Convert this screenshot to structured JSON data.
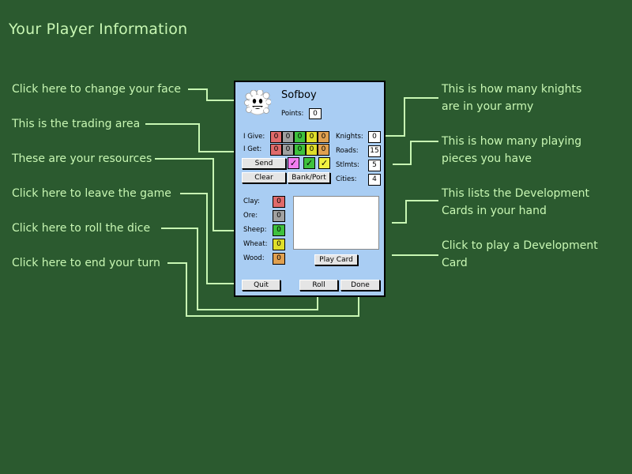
{
  "page": {
    "title": "Your Player Information"
  },
  "callouts": {
    "face": "Click here to change your face",
    "trading": "This is the trading area",
    "resources": "These are your resources",
    "quit": "Click here to leave the game",
    "roll": "Click here to roll the dice",
    "done": "Click here to end your turn",
    "knights_1": "This is how many knights",
    "knights_2": "are in your army",
    "pieces_1": "This is how many playing",
    "pieces_2": "pieces you have",
    "cards_1": "This lists the Development",
    "cards_2": "Cards in your hand",
    "play_1": "Click to play a Development",
    "play_2": "Card"
  },
  "player": {
    "name": "Sofboy",
    "points_label": "Points:",
    "points": "0",
    "face_icon": "smiley-face-icon"
  },
  "trade": {
    "give_label": "I Give:",
    "get_label": "I Get:",
    "give": [
      "0",
      "0",
      "0",
      "0",
      "0"
    ],
    "get": [
      "0",
      "0",
      "0",
      "0",
      "0"
    ],
    "send_label": "Send",
    "clear_label": "Clear",
    "bankport_label": "Bank/Port",
    "checks": [
      "✓",
      "✓",
      "✓"
    ]
  },
  "stats": {
    "knights_label": "Knights:",
    "knights": "0",
    "roads_label": "Roads:",
    "roads": "15",
    "stlmts_label": "Stlmts:",
    "stlmts": "5",
    "cities_label": "Cities:",
    "cities": "4"
  },
  "resources": {
    "clay_label": "Clay:",
    "clay": "0",
    "ore_label": "Ore:",
    "ore": "0",
    "sheep_label": "Sheep:",
    "sheep": "0",
    "wheat_label": "Wheat:",
    "wheat": "0",
    "wood_label": "Wood:",
    "wood": "0"
  },
  "buttons": {
    "play_card": "Play Card",
    "quit": "Quit",
    "roll": "Roll",
    "done": "Done"
  },
  "colors": {
    "background": "#2b5a2f",
    "text": "#c8f7b3",
    "panel": "#a9cdf3",
    "clay": "#e06a6a",
    "ore": "#a0a0a0",
    "sheep": "#3ec13e",
    "wheat": "#dede2a",
    "wood": "#e0a050",
    "check_pink": "#f07ef0",
    "check_green": "#3ec13e",
    "check_yellow": "#f0f040"
  }
}
